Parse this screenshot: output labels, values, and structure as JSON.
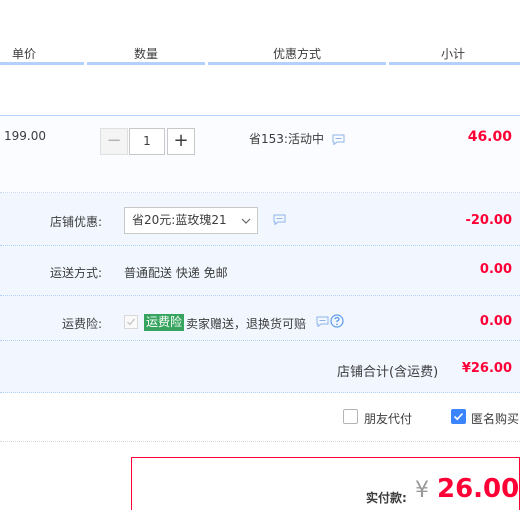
{
  "header": {
    "unit_price": "单价",
    "quantity": "数量",
    "discount": "优惠方式",
    "subtotal": "小计"
  },
  "item": {
    "price": "199.00",
    "minus": "−",
    "qty": "1",
    "plus": "+",
    "promo": "省153:活动中",
    "subtotal": "46.00"
  },
  "shop": {
    "coupon_label": "店铺优惠:",
    "coupon_selected": "省20元:蓝玫瑰21",
    "coupon_amount": "-20.00",
    "shipping_label": "运送方式:",
    "shipping_value": "普通配送 快递 免邮",
    "shipping_amount": "0.00",
    "insurance_label": "运费险:",
    "insurance_badge": "运费险",
    "insurance_text": "卖家赠送，退换货可赔",
    "insurance_amount": "0.00",
    "total_label": "店铺合计(含运费)",
    "total_value": "¥26.00"
  },
  "options": {
    "friend_pay": "朋友代付",
    "anonymous": "匿名购买"
  },
  "payment": {
    "label": "实付款:",
    "currency": "¥",
    "amount": "26.00"
  },
  "colors": {
    "accent": "#ff0036",
    "border_blue": "#b2d1ff",
    "panel_bg": "#f2f7ff",
    "checkbox_blue": "#3a84ff",
    "badge_green": "#36a45e"
  }
}
